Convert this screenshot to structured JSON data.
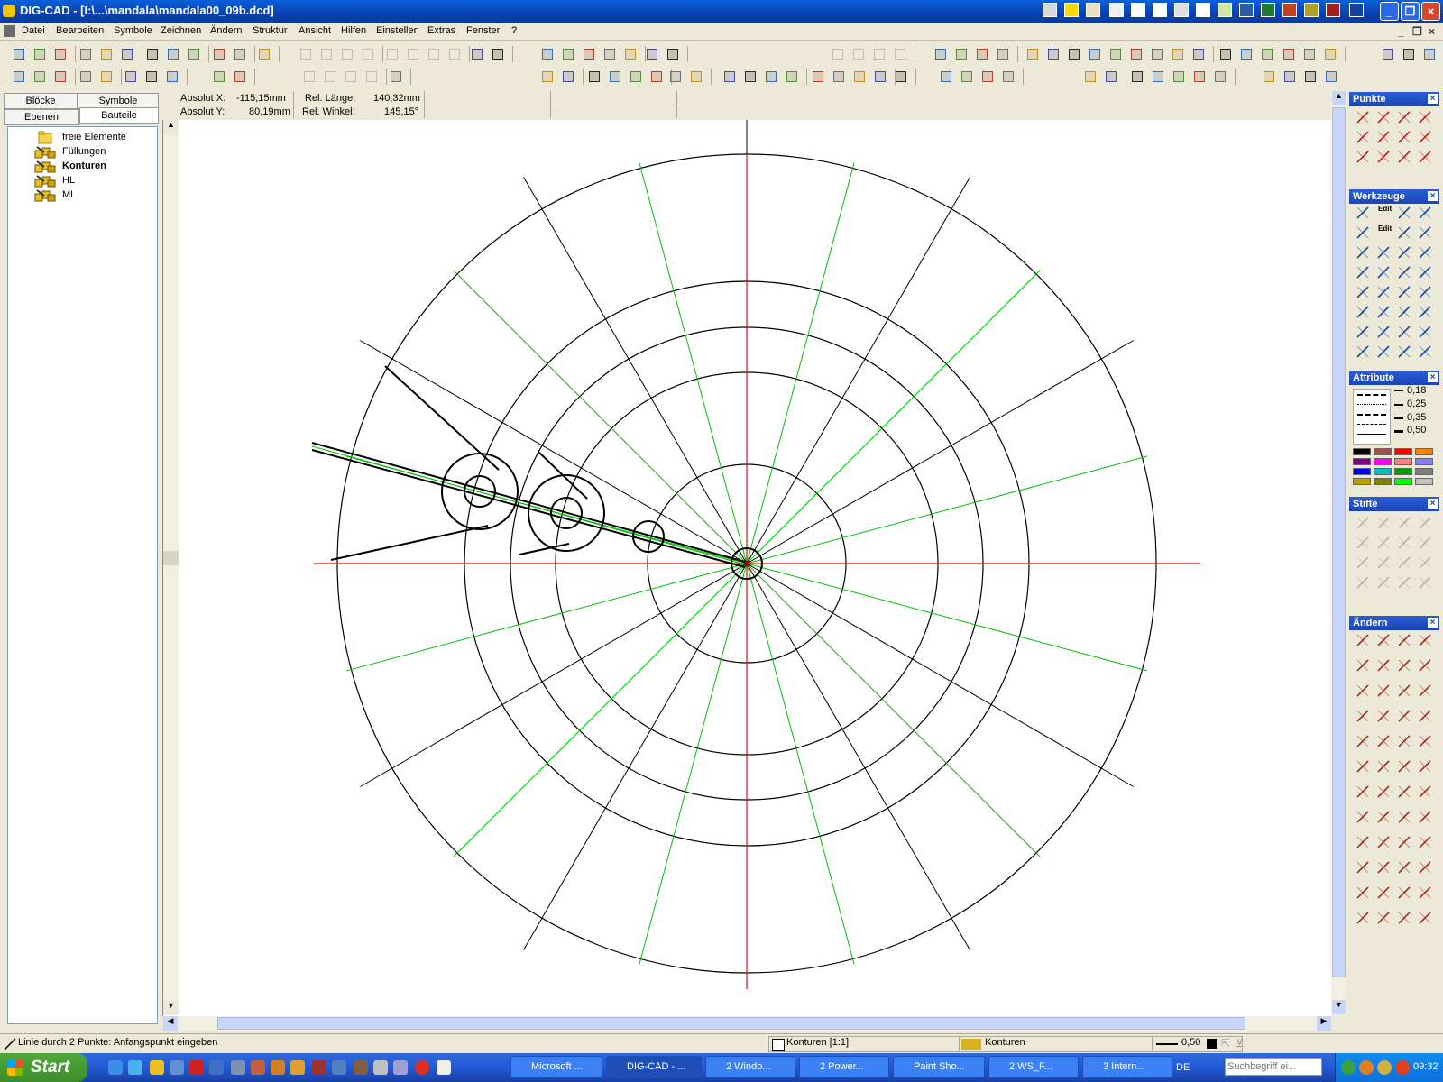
{
  "window": {
    "title": "DIG-CAD - [I:\\...\\mandala\\mandala00_09b.dcd]"
  },
  "menu": [
    "Datei",
    "Bearbeiten",
    "Symbole",
    "Zeichnen",
    "Ändern",
    "Struktur",
    "Ansicht",
    "Hilfen",
    "Einstellen",
    "Extras",
    "Fenster",
    "?"
  ],
  "left_tabs": {
    "row1": [
      "Blöcke",
      "Symbole"
    ],
    "row2": [
      "Ebenen",
      "Bauteile"
    ],
    "active": "Bauteile"
  },
  "tree": [
    "freie Elemente",
    "Füllungen",
    "Konturen",
    "HL",
    "ML"
  ],
  "tree_bold": "Konturen",
  "coords": {
    "abs_x_label": "Absolut X:",
    "abs_x_value": "-115,15mm",
    "abs_y_label": "Absolut Y:",
    "abs_y_value": "80,19mm",
    "rel_len_label": "Rel. Länge:",
    "rel_len_value": "140,32mm",
    "rel_ang_label": "Rel. Winkel:",
    "rel_ang_value": "145,15°"
  },
  "palettes": {
    "punkte": "Punkte",
    "werkzeuge": "Werkzeuge",
    "attribute": "Attribute",
    "stifte": "Stifte",
    "aendern": "Ändern"
  },
  "werkzeuge_edit": [
    "Edit",
    "Edit"
  ],
  "line_widths": [
    "0,18",
    "0,25",
    "0,35",
    "0,50"
  ],
  "color_swatches": [
    "#000000",
    "#a05050",
    "#ff0000",
    "#ff8000",
    "#800080",
    "#ff00ff",
    "#ff8080",
    "#8080ff",
    "#0000ff",
    "#00c0c0",
    "#00a000",
    "#808080",
    "#c0a000",
    "#808000",
    "#00ff00",
    "#c0c0c0"
  ],
  "status": {
    "hint": "Linie durch 2 Punkte: Anfangspunkt eingeben",
    "layer": "Konturen [1:1]",
    "part": "Konturen",
    "width": "0,50"
  },
  "taskbar": {
    "start": "Start",
    "tasks": [
      "Microsoft ...",
      "DIG-CAD - ...",
      "2 Windo...",
      "2 Power...",
      "Paint Sho...",
      "2 WS_F...",
      "3 Intern..."
    ],
    "active_task": "DIG-CAD - ...",
    "search_placeholder": "Suchbegriff ei...",
    "lang": "DE",
    "clock": "09:32"
  },
  "drawing": {
    "ring_radii": [
      110,
      212,
      262,
      313,
      454
    ],
    "black_spoke_angles": [
      30,
      60,
      90,
      120,
      150,
      210,
      240,
      300,
      330
    ],
    "green_spoke_angles": [
      15,
      45,
      75,
      105,
      135,
      165,
      195,
      225,
      255,
      285,
      315,
      345
    ],
    "colors": {
      "axis": "#ff0000",
      "spoke_black": "#000000",
      "spoke_green": "#00c000",
      "ring": "#000000"
    }
  }
}
